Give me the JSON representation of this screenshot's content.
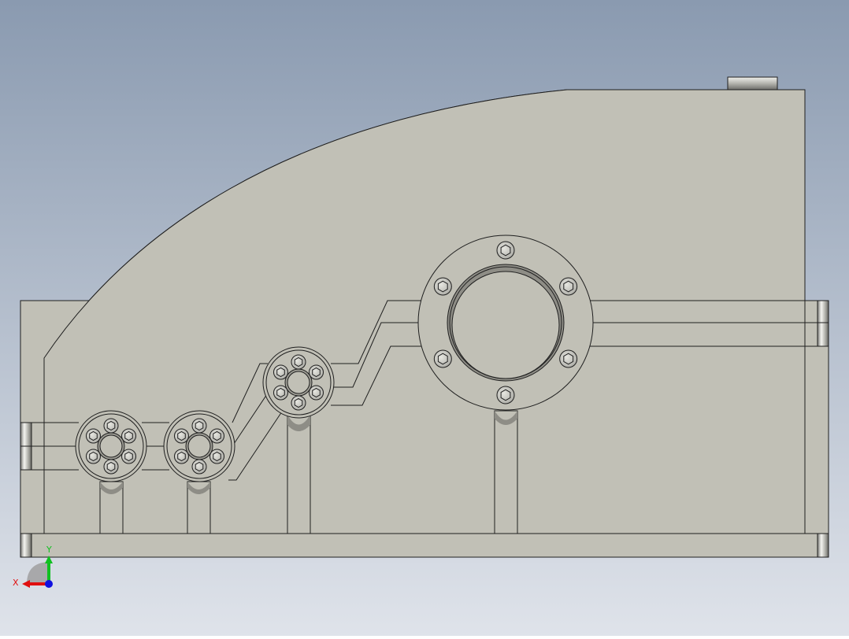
{
  "viewport": {
    "background_top": "#8a9ab0",
    "background_bottom": "#dfe3ea"
  },
  "model": {
    "body_color": "#c1c0b6",
    "edge_color": "#1f1f1f",
    "plug_color": "#b8b8b4"
  },
  "triad": {
    "x_label": "X",
    "y_label": "Y",
    "x_color": "#e01010",
    "y_color": "#10c020",
    "z_color": "#1010e0"
  }
}
